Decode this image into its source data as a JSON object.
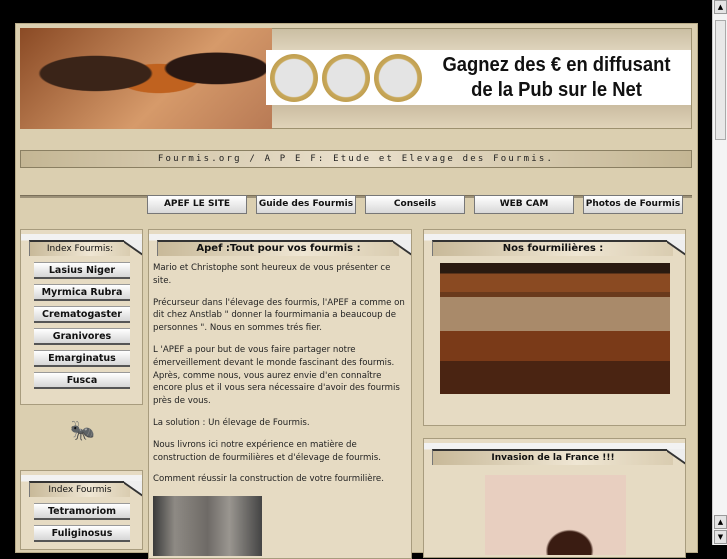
{
  "banner": {
    "ad_line1": "Gagnez des € en diffusant",
    "ad_line2": "de la Pub sur le Net"
  },
  "title_bar": "Fourmis.org / A P E F: Etude et Elevage des Fourmis.",
  "nav": [
    "APEF LE SITE",
    "Guide des Fourmis",
    "Conseils",
    "WEB CAM",
    "Photos de Fourmis"
  ],
  "left_panel_1": {
    "title": "Index Fourmis:",
    "items": [
      "Lasius Niger",
      "Myrmica Rubra",
      "Crematogaster",
      "Granivores",
      "Emarginatus",
      "Fusca"
    ]
  },
  "left_panel_2": {
    "title": "Index Fourmis",
    "items": [
      "Tetramoriom",
      "Fuliginosus"
    ]
  },
  "main": {
    "title": "Apef :Tout pour vos fourmis :",
    "paragraphs": [
      "Mario et Christophe sont heureux de vous présenter ce site.",
      "Précurseur dans l'élevage des fourmis, l'APEF a comme on dit chez Anstlab \" donner la fourmimania a beaucoup de personnes \". Nous en sommes trés fier.",
      "L 'APEF a pour but de vous faire partager notre émerveillement devant le monde fascinant des fourmis. Après, comme nous, vous aurez envie d'en connaître encore plus et il vous sera nécessaire d'avoir des fourmis près de vous.",
      "La solution : Un élevage de Fourmis.",
      "Nous livrons ici notre expérience en matière de construction de fourmilières et d'élevage de fourmis.",
      "Comment réussir la construction de votre fourmilière."
    ]
  },
  "right_panel_1": {
    "title": "Nos fourmilières :"
  },
  "right_panel_2": {
    "title": "Invasion de la France !!!"
  },
  "scrollbar": {
    "up": "▲",
    "down": "▼"
  }
}
